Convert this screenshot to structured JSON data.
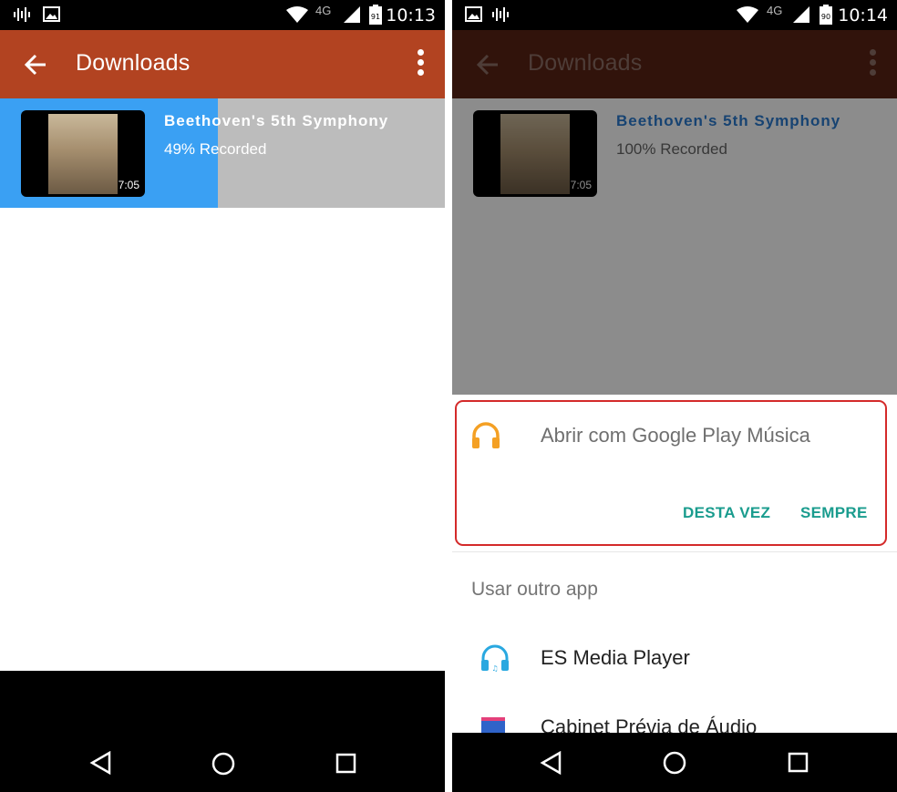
{
  "left": {
    "status": {
      "network": "4G",
      "battery": "91",
      "time": "10:13"
    },
    "app_bar": {
      "title": "Downloads"
    },
    "item": {
      "title": "Beethoven's 5th Symphony",
      "status": "49% Recorded",
      "duration": "7:05",
      "progress": 0.49
    }
  },
  "right": {
    "status": {
      "network": "4G",
      "battery": "90",
      "time": "10:14"
    },
    "app_bar": {
      "title": "Downloads"
    },
    "item": {
      "title": "Beethoven's 5th Symphony",
      "status": "100% Recorded",
      "duration": "7:05"
    },
    "dialog": {
      "open_with": "Abrir com Google Play Música",
      "just_once": "DESTA VEZ",
      "always": "SEMPRE",
      "other_app": "Usar outro app",
      "apps": [
        "ES Media Player",
        "Cabinet Prévia de Áudio"
      ]
    }
  },
  "colors": {
    "app_bar": "#b24321",
    "progress": "#3aa0f3",
    "accent": "#1a9c8e",
    "highlight": "#d42a2a"
  },
  "icons": [
    "wave-icon",
    "image-icon",
    "wifi-icon",
    "signal-icon",
    "battery-icon",
    "back-arrow-icon",
    "more-vert-icon",
    "headphones-icon",
    "back-nav-icon",
    "home-nav-icon",
    "recents-nav-icon"
  ]
}
